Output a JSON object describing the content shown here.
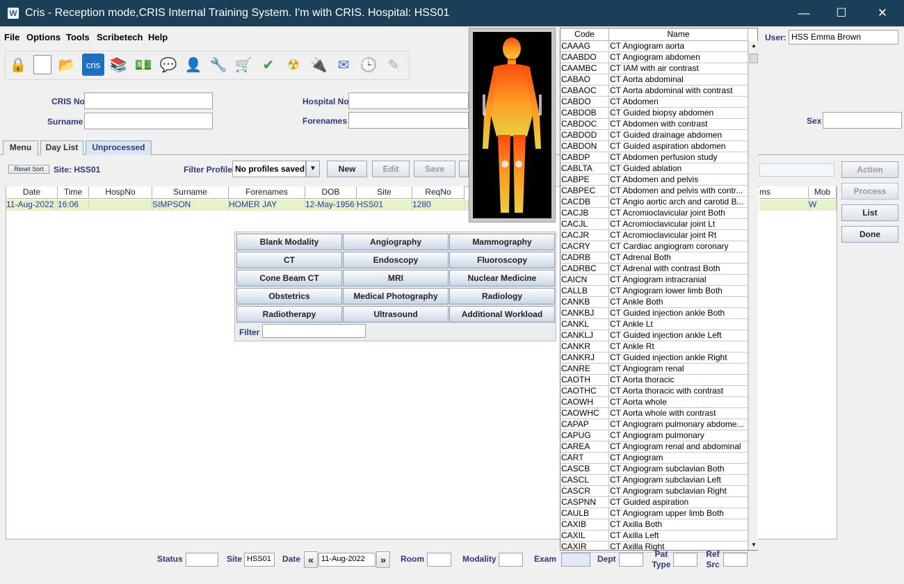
{
  "window": {
    "title": "Cris - Reception mode,CRIS Internal Training System. I'm with CRIS.   Hospital: HSS01",
    "app_icon": "cris-logo-icon",
    "minimize": "—",
    "maximize": "☐",
    "close": "✕"
  },
  "menu": {
    "file": "File",
    "options": "Options",
    "tools": "Tools",
    "scribetech": "Scribetech",
    "help": "Help"
  },
  "toolbar": {
    "icons": [
      "lock-icon",
      "blank-page-icon",
      "folder-icon",
      "cris-icon",
      "books-icon",
      "money-icon",
      "chat-icon",
      "person-icon",
      "wrench-icon",
      "cart-icon",
      "checkmark-icon",
      "radiation-icon",
      "plug-icon",
      "envelope-icon",
      "clock-window-icon",
      "disabled-tool-icon"
    ],
    "cris_label": "cris"
  },
  "user": {
    "label": "User:",
    "value": "HSS Emma Brown"
  },
  "search": {
    "cris_no_label": "CRIS No",
    "cris_no_value": "",
    "hospital_no_label": "Hospital No",
    "hospital_no_value": "",
    "surname_label": "Surname",
    "surname_value": "",
    "forenames_label": "Forenames",
    "forenames_value": "",
    "sex_label": "Sex",
    "sex_value": ""
  },
  "tabs": [
    "Menu",
    "Day List",
    "Unprocessed"
  ],
  "list_toolbar": {
    "reset_sort": "Reset Sort",
    "site_label": "Site: HSS01",
    "filter_profile_label": "Filter Profile",
    "filter_profile_value": "No profiles saved",
    "new": "New",
    "edit": "Edit",
    "save": "Save"
  },
  "side_buttons": {
    "action": "Action",
    "process": "Process",
    "list": "List",
    "done": "Done"
  },
  "table": {
    "headers": [
      "Date",
      "Time",
      "HospNo",
      "Surname",
      "Forenames",
      "DOB",
      "Site",
      "ReqNo"
    ],
    "extra_headers": [
      "ms",
      "Mob"
    ],
    "rows": [
      {
        "date": "11-Aug-2022",
        "time": "16:06",
        "hospno": "",
        "surname": "SIMPSON",
        "forenames": "HOMER JAY",
        "dob": "12-May-1956",
        "site": "HSS01",
        "reqno": "1280",
        "mob": "W"
      }
    ]
  },
  "modalities": {
    "buttons": [
      "Blank Modality",
      "Angiography",
      "Mammography",
      "CT",
      "Endoscopy",
      "Fluoroscopy",
      "Cone Beam CT",
      "MRI",
      "Nuclear Medicine",
      "Obstetrics",
      "Medical Photography",
      "Radiology",
      "Radiotherapy",
      "Ultrasound",
      "Additional Workload"
    ],
    "filter_label": "Filter",
    "filter_value": ""
  },
  "exam_list": {
    "headers": {
      "code": "Code",
      "name": "Name"
    },
    "rows": [
      [
        "CAAAG",
        "CT Angiogram aorta"
      ],
      [
        "CAABDO",
        "CT Angiogram abdomen"
      ],
      [
        "CAAMBC",
        "CT IAM with air contrast"
      ],
      [
        "CABAO",
        "CT Aorta abdominal"
      ],
      [
        "CABAOC",
        "CT Aorta abdominal with contrast"
      ],
      [
        "CABDO",
        "CT Abdomen"
      ],
      [
        "CABDOB",
        "CT Guided biopsy abdomen"
      ],
      [
        "CABDOC",
        "CT Abdomen with contrast"
      ],
      [
        "CABDOD",
        "CT Guided drainage abdomen"
      ],
      [
        "CABDON",
        "CT Guided aspiration abdomen"
      ],
      [
        "CABDP",
        "CT Abdomen perfusion study"
      ],
      [
        "CABLTA",
        "CT Guided ablation"
      ],
      [
        "CABPE",
        "CT Abdomen and pelvis"
      ],
      [
        "CABPEC",
        "CT Abdomen and pelvis with contr..."
      ],
      [
        "CACDB",
        "CT Angio aortic arch and carotid B..."
      ],
      [
        "CACJB",
        "CT Acromioclavicular joint Both"
      ],
      [
        "CACJL",
        "CT Acromioclavicular joint Lt"
      ],
      [
        "CACJR",
        "CT Acromioclavicular joint Rt"
      ],
      [
        "CACRY",
        "CT Cardiac angiogram coronary"
      ],
      [
        "CADRB",
        "CT Adrenal Both"
      ],
      [
        "CADRBC",
        "CT Adrenal with contrast Both"
      ],
      [
        "CAICN",
        "CT Angiogram intracranial"
      ],
      [
        "CALLB",
        "CT Angiogram lower limb Both"
      ],
      [
        "CANKB",
        "CT Ankle Both"
      ],
      [
        "CANKBJ",
        "CT Guided injection ankle Both"
      ],
      [
        "CANKL",
        "CT Ankle Lt"
      ],
      [
        "CANKLJ",
        "CT Guided injection ankle Left"
      ],
      [
        "CANKR",
        "CT Ankle Rt"
      ],
      [
        "CANKRJ",
        "CT Guided injection ankle Right"
      ],
      [
        "CANRE",
        "CT Angiogram renal"
      ],
      [
        "CAOTH",
        "CT Aorta thoracic"
      ],
      [
        "CAOTHC",
        "CT Aorta thoracic with contrast"
      ],
      [
        "CAOWH",
        "CT Aorta whole"
      ],
      [
        "CAOWHC",
        "CT Aorta whole with contrast"
      ],
      [
        "CAPAP",
        "CT Angiogram pulmonary abdome..."
      ],
      [
        "CAPUG",
        "CT Angiogram pulmonary"
      ],
      [
        "CAREA",
        "CT Angiogram renal and abdominal"
      ],
      [
        "CART",
        "CT Angiogram"
      ],
      [
        "CASCB",
        "CT Angiogram subclavian Both"
      ],
      [
        "CASCL",
        "CT Angiogram subclavian Left"
      ],
      [
        "CASCR",
        "CT Angiogram subclavian Right"
      ],
      [
        "CASPNN",
        "CT Guided aspiration"
      ],
      [
        "CAULB",
        "CT Angiogram upper limb Both"
      ],
      [
        "CAXIB",
        "CT Axilla Both"
      ],
      [
        "CAXIL",
        "CT Axilla Left"
      ],
      [
        "CAXIR",
        "CT Axilla Right"
      ]
    ]
  },
  "bottom": {
    "status_label": "Status",
    "status_value": "",
    "site_label": "Site",
    "site_value": "HSS01",
    "date_label": "Date",
    "date_value": "11-Aug-2022",
    "room_label": "Room",
    "modality_label": "Modality",
    "exam_label": "Exam",
    "dept_label": "Dept",
    "pat_type_label": "Pat Type",
    "ref_src_label": "Ref Src"
  },
  "colors": {
    "titlebar": "#1b3f57",
    "label_blue": "#2b3a80",
    "row_highlight": "#e6f2c9"
  }
}
